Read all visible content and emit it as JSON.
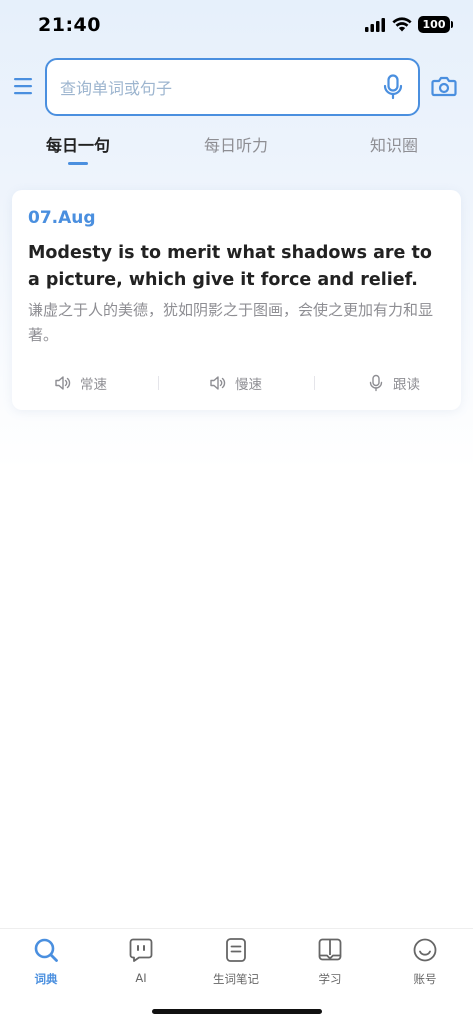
{
  "status_bar": {
    "time": "21:40",
    "battery": "100",
    "icons": [
      "signal-icon",
      "wifi-icon",
      "battery-icon"
    ]
  },
  "search": {
    "placeholder": "查询单词或句子",
    "value": "",
    "icons": [
      "menu-icon",
      "microphone-icon",
      "camera-icon"
    ]
  },
  "tabs": [
    {
      "label": "每日一句",
      "active": true
    },
    {
      "label": "每日听力",
      "active": false
    },
    {
      "label": "知识圈",
      "active": false
    }
  ],
  "daily_sentence": {
    "date": "07.Aug",
    "english": "Modesty is to merit what shadows are to a picture, which give it force and relief.",
    "chinese": "谦虚之于人的美德，犹如阴影之于图画，会使之更加有力和显著。",
    "actions": [
      {
        "label": "常速",
        "icon": "speaker-icon"
      },
      {
        "label": "慢速",
        "icon": "speaker-icon"
      },
      {
        "label": "跟读",
        "icon": "microphone-icon"
      }
    ]
  },
  "bottom_nav": [
    {
      "label": "词典",
      "icon": "search-icon",
      "active": true
    },
    {
      "label": "AI",
      "icon": "ai-chat-icon",
      "active": false
    },
    {
      "label": "生词笔记",
      "icon": "notes-icon",
      "active": false
    },
    {
      "label": "学习",
      "icon": "book-icon",
      "active": false
    },
    {
      "label": "账号",
      "icon": "smiley-icon",
      "active": false
    }
  ],
  "colors": {
    "accent": "#4a8fdf",
    "muted_text": "#8e8e93",
    "primary_text": "#222222"
  }
}
